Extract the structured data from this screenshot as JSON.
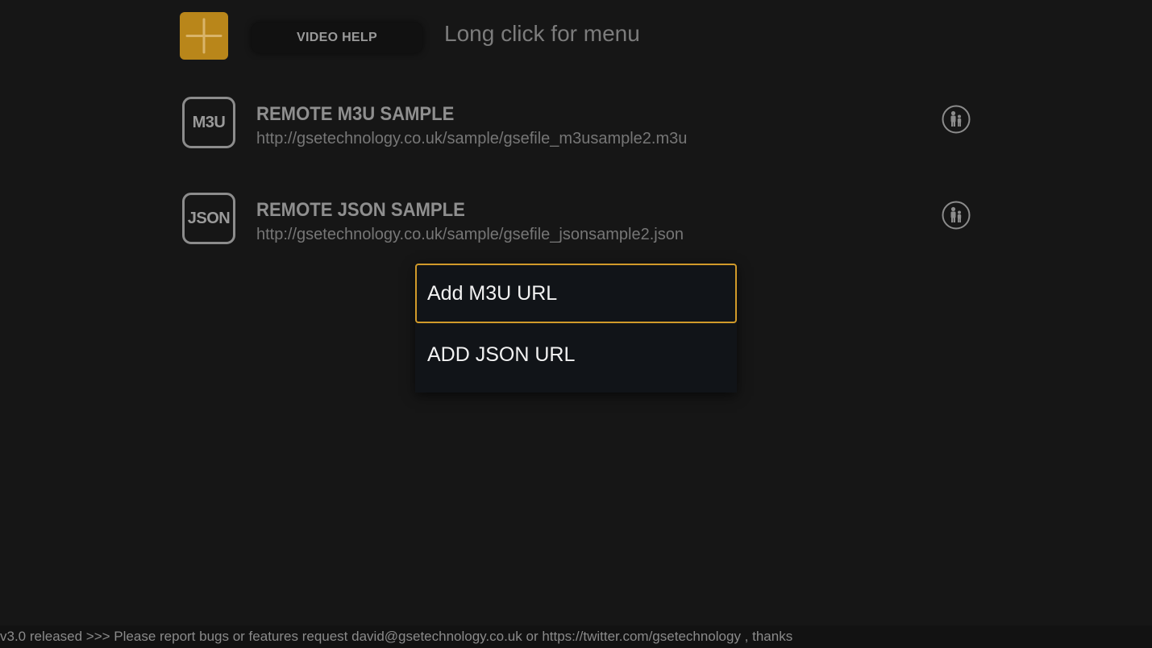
{
  "header": {
    "add_icon": "plus-icon",
    "video_help_label": "VIDEO HELP",
    "hint": "Long click for menu"
  },
  "playlists": [
    {
      "badge": "M3U",
      "title": "REMOTE M3U SAMPLE",
      "url": "http://gsetechnology.co.uk/sample/gsefile_m3usample2.m3u",
      "icon": "parental-control-icon"
    },
    {
      "badge": "JSON",
      "title": "REMOTE JSON SAMPLE",
      "url": "http://gsetechnology.co.uk/sample/gsefile_jsonsample2.json",
      "icon": "parental-control-icon"
    }
  ],
  "menu": {
    "items": [
      {
        "label": "Add M3U URL",
        "selected": true
      },
      {
        "label": "ADD JSON URL",
        "selected": false
      }
    ]
  },
  "ticker": {
    "text": "v3.0 released >>>  Please report bugs or features request david@gsetechnology.co.uk or https://twitter.com/gsetechnology , thanks"
  },
  "colors": {
    "background": "#161616",
    "accent": "#b9861a",
    "focus_border": "#d19a2a",
    "menu_bg": "#111418"
  }
}
